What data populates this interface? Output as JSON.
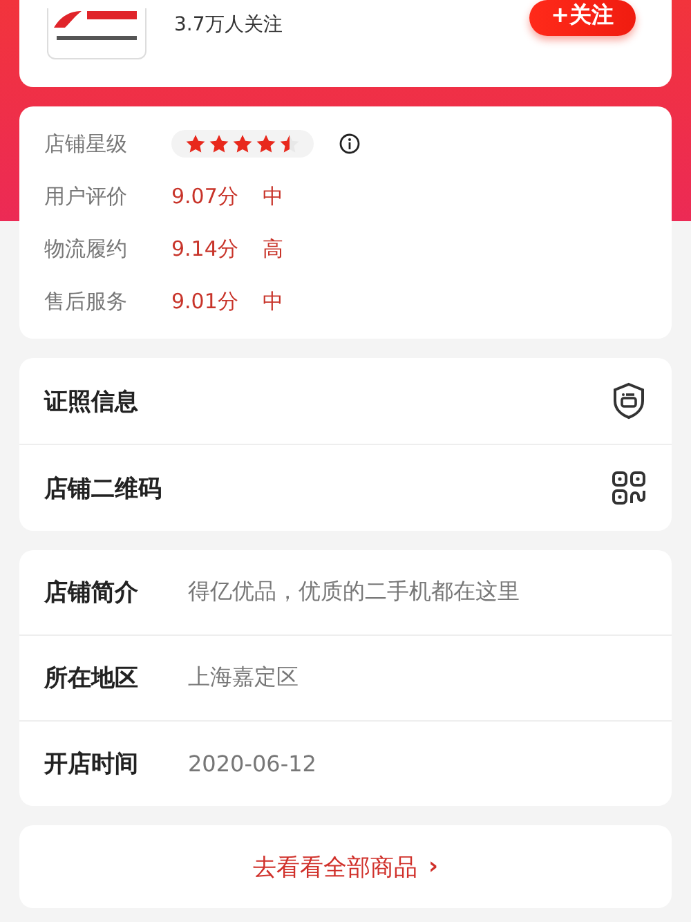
{
  "shop": {
    "followers": "3.7万人关注",
    "follow_button": "+关注"
  },
  "ratings": {
    "star_label": "店铺星级",
    "stars": 4.5,
    "rows": [
      {
        "label": "用户评价",
        "score": "9.07分",
        "grade": "中"
      },
      {
        "label": "物流履约",
        "score": "9.14分",
        "grade": "高"
      },
      {
        "label": "售后服务",
        "score": "9.01分",
        "grade": "中"
      }
    ]
  },
  "links": [
    {
      "label": "证照信息",
      "kind": "license"
    },
    {
      "label": "店铺二维码",
      "kind": "qrcode"
    }
  ],
  "info": [
    {
      "label": "店铺简介",
      "value": "得亿优品，优质的二手机都在这里"
    },
    {
      "label": "所在地区",
      "value": "上海嘉定区"
    },
    {
      "label": "开店时间",
      "value": "2020-06-12"
    }
  ],
  "all_goods_button": {
    "label": "去看看全部商品",
    "arrow": "›"
  }
}
